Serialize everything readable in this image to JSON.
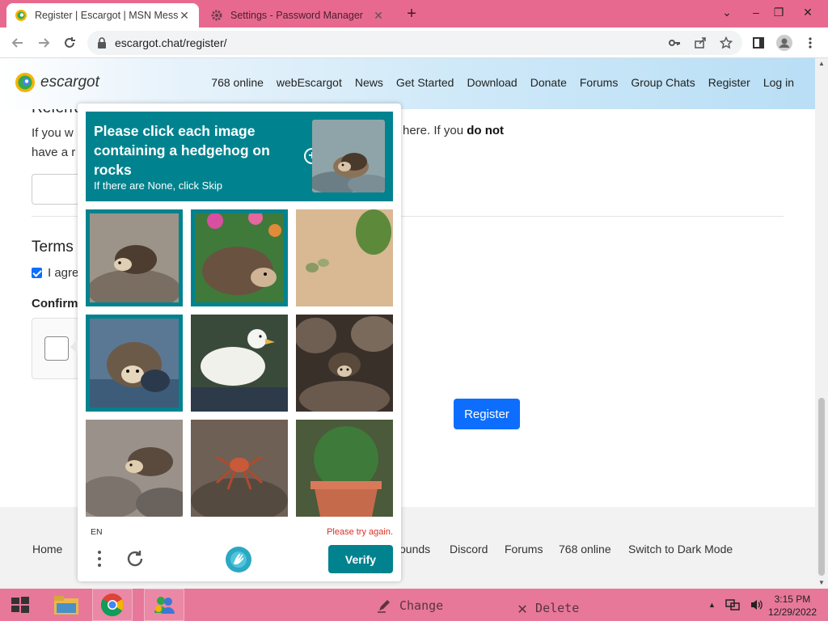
{
  "browser": {
    "tabs": [
      {
        "title": "Register | Escargot | MSN Messen",
        "active": true
      },
      {
        "title": "Settings - Password Manager",
        "active": false
      }
    ],
    "url": "escargot.chat/register/"
  },
  "site": {
    "logo_text": "escargot",
    "nav": [
      "768 online",
      "webEscargot",
      "News",
      "Get Started",
      "Download",
      "Donate",
      "Forums",
      "Group Chats",
      "Register",
      "Log in"
    ]
  },
  "page": {
    "referral_heading": "Referral",
    "para_line1_left": "If you w",
    "para_line2_left": "have a r",
    "para_right_prefix": "here. If you ",
    "para_right_bold": "do not",
    "terms_heading": "Terms",
    "agree_text": "I agre",
    "confirm_heading": "Confirm",
    "register_label": "Register"
  },
  "footer": {
    "links": [
      "Home",
      "ounds",
      "Discord",
      "Forums",
      "768 online",
      "Switch to Dark Mode"
    ]
  },
  "captcha": {
    "prompt": "Please click each image containing a hedgehog on rocks",
    "sub": "If there are None, click Skip",
    "language": "EN",
    "error": "Please try again.",
    "verify_label": "Verify",
    "images": [
      {
        "subject": "hedgehog on rock",
        "selected": true
      },
      {
        "subject": "hedgehog with flowers",
        "selected": true
      },
      {
        "subject": "cactus on sand",
        "selected": false
      },
      {
        "subject": "hedgehog in water",
        "selected": true
      },
      {
        "subject": "white duck",
        "selected": false
      },
      {
        "subject": "hedgehog between rocks",
        "selected": false
      },
      {
        "subject": "hedgehog on rocks",
        "selected": false
      },
      {
        "subject": "crab on rock",
        "selected": false
      },
      {
        "subject": "cactus in pot",
        "selected": false
      }
    ],
    "accent": "#00838f"
  },
  "taskbar": {
    "change_label": "Change",
    "delete_label": "Delete",
    "time": "3:15 PM",
    "date": "12/29/2022"
  }
}
